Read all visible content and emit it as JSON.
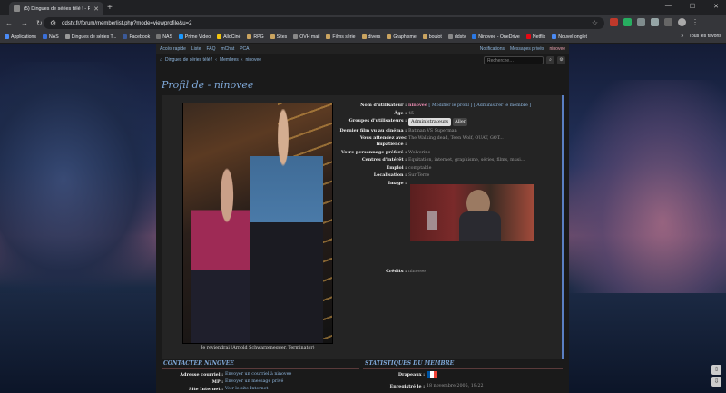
{
  "browser": {
    "tab_title": "(5) Dingues de séries télé ! - P…",
    "url": "ddstv.fr/forum/memberlist.php?mode=viewprofile&u=2",
    "bookmarks": [
      "Applications",
      "NAS",
      "Dingues de séries T...",
      "Facebook",
      "NAS",
      "Prime Video",
      "AlloCiné",
      "RPG",
      "Sites",
      "OVH mail",
      "Films série",
      "divers",
      "Graphisme",
      "boulot",
      "ddstv",
      "Ninovee - OneDrive",
      "Netflix",
      "Nouvel onglet"
    ],
    "bookmarks_all": "Tous les favoris"
  },
  "forum": {
    "topnav": [
      "Accès rapide",
      "Liste",
      "FAQ",
      "mChat",
      "PCA"
    ],
    "notifications": "Notifications",
    "messages": "Messages privés",
    "username": "ninovee",
    "breadcrumb": [
      "Dingues de séries télé !",
      "Membres",
      "ninovee"
    ],
    "search_placeholder": "Recherche…",
    "page_title": "Profil de - ninovee"
  },
  "profile": {
    "caption": "Je reviendrai (Arnold Schwarzenegger, Terminator)",
    "fields": [
      {
        "label": "Nom d'utilisateur :",
        "value": "ninovee",
        "links": "[ Modifier le profil ] [ Administrer le membre ]"
      },
      {
        "label": "Âge :",
        "value": "45"
      },
      {
        "label": "Groupes d'utilisateurs :",
        "select": "Administrateurs",
        "button": "Aller"
      },
      {
        "label": "Dernier film vu au cinéma :",
        "value": "Batman VS Superman"
      },
      {
        "label": "Vous attendez avec impatience :",
        "value": "The Walking dead, Teen Wolf, OUAT, GOT..."
      },
      {
        "label": "Votre personnage préféré :",
        "value": "Wolverine"
      },
      {
        "label": "Centres d'intérêt :",
        "value": "Equitation, internet, graphisme, séries, films, musi..."
      },
      {
        "label": "Emploi :",
        "value": "comptable"
      },
      {
        "label": "Localisation :",
        "value": "Sur Terre"
      },
      {
        "label": "Image :",
        "value": ""
      },
      {
        "label": "Crédits :",
        "value": "ninovee"
      }
    ]
  },
  "contact": {
    "title": "CONTACTER NINOVEE",
    "rows": [
      {
        "label": "Adresse courriel :",
        "value": "Envoyer un courriel à ninovee"
      },
      {
        "label": "MP :",
        "value": "Envoyer un message privé"
      },
      {
        "label": "Site Internet :",
        "value": "Voir le site Internet"
      }
    ]
  },
  "stats": {
    "title": "STATISTIQUES DU MEMBRE",
    "rows": [
      {
        "label": "Drapeaux :",
        "value": ""
      },
      {
        "label": "Enregistré le :",
        "value": "18 novembre 2005, 19:22"
      }
    ]
  }
}
